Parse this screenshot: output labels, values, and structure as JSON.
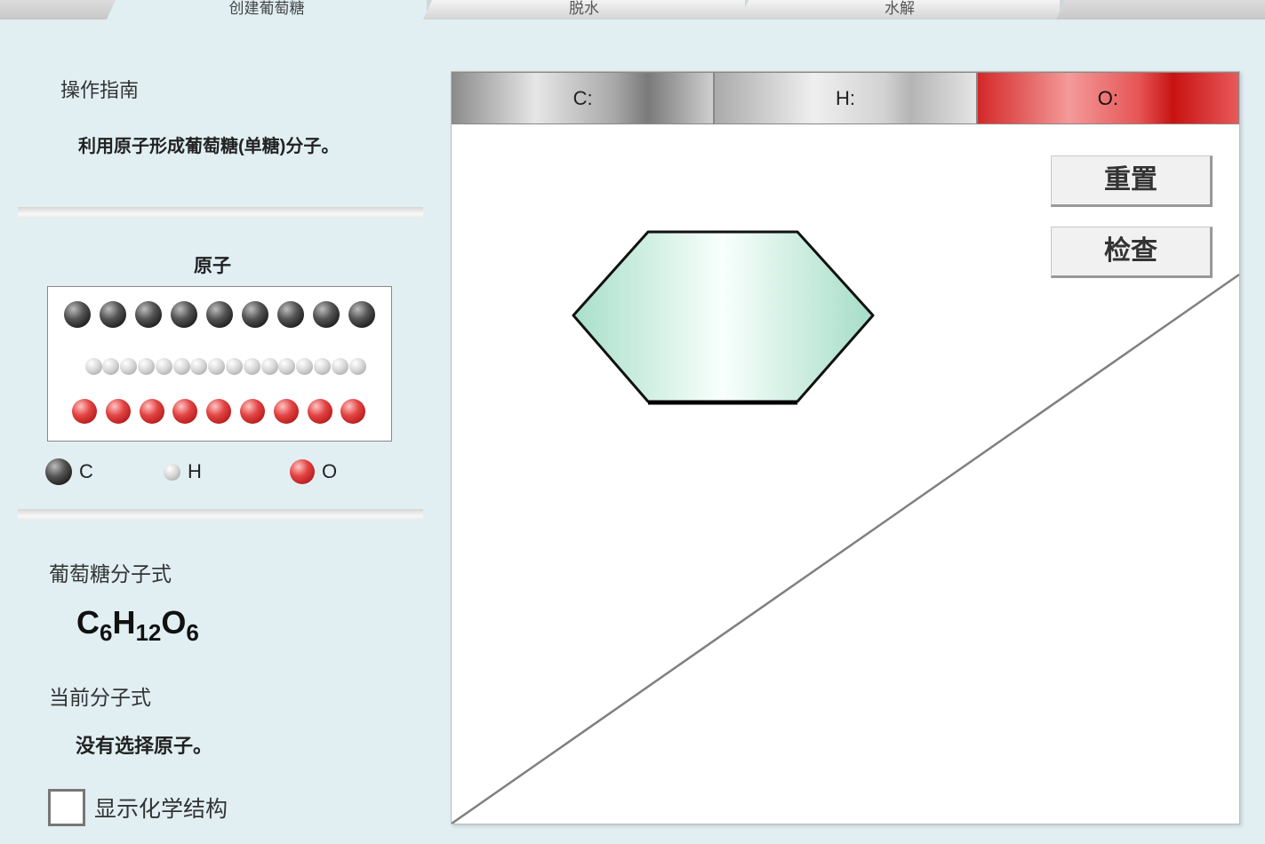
{
  "tabs": [
    "创建葡萄糖",
    "脱水",
    "水解"
  ],
  "left": {
    "guide_title": "操作指南",
    "guide_text": "利用原子形成葡萄糖(单糖)分子。",
    "atoms_title": "原子",
    "legend": {
      "c": "C",
      "h": "H",
      "o": "O"
    },
    "glucose_formula_label": "葡萄糖分子式",
    "glucose_formula": {
      "c": "C",
      "c_n": "6",
      "h": "H",
      "h_n": "12",
      "o": "O",
      "o_n": "6"
    },
    "current_formula_label": "当前分子式",
    "current_formula_text": "没有选择原子。",
    "show_structure_label": "显示化学结构"
  },
  "atom_pool": {
    "carbon_count": 9,
    "hydrogen_count": 16,
    "oxygen_count": 9
  },
  "counts": {
    "c_label": "C:",
    "h_label": "H:",
    "o_label": "O:"
  },
  "buttons": {
    "reset": "重置",
    "check": "检查"
  },
  "colors": {
    "background": "#e1eff3",
    "carbon": "#333333",
    "hydrogen": "#d0d0d0",
    "oxygen": "#d42828",
    "ring_fill": "#b5e3d1"
  }
}
